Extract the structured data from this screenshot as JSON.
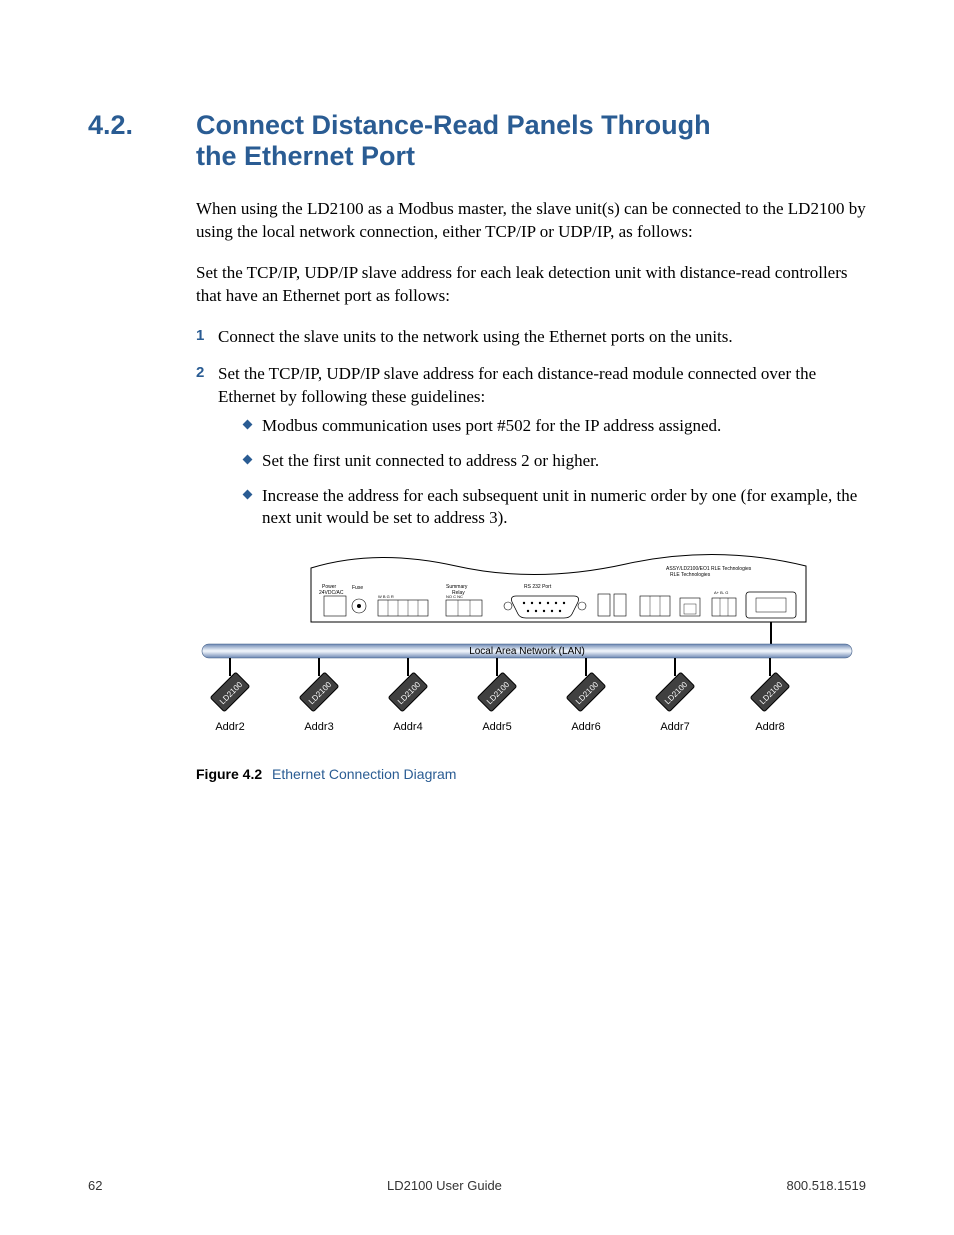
{
  "heading": {
    "number": "4.2.",
    "title": "Connect Distance-Read Panels Through the Ethernet Port"
  },
  "paragraphs": {
    "intro1": "When using the LD2100 as a Modbus master, the slave unit(s) can be connected to the LD2100 by using the local network connection, either TCP/IP or UDP/IP, as follows:",
    "intro2": "Set the TCP/IP, UDP/IP slave address for each leak detection unit with distance-read controllers that have an Ethernet port as follows:"
  },
  "steps": [
    "Connect the slave units to the network using the Ethernet ports on the units.",
    "Set the TCP/IP, UDP/IP slave address for each distance-read module connected over the Ethernet by following these guidelines:"
  ],
  "bullets": [
    "Modbus communication uses port #502 for the IP address assigned.",
    "Set the first unit connected to address 2 or higher.",
    "Increase the address for each subsequent unit in numeric order by one (for example, the next unit would be set to address 3)."
  ],
  "figure": {
    "caption_label": "Figure 4.2",
    "caption_title": "Ethernet Connection Diagram",
    "lan_label": "Local Area Network (LAN)",
    "panel_labels": {
      "power": "Power\n24VDC/AC",
      "fuse": "Fuse",
      "relay": "Summary\nRelay",
      "relay_pins": "NO  C  NC",
      "rs232": "RS 232 Port",
      "assy": "ASSY/LD2100/EO1\nRLE Technologies"
    },
    "device_label": "LD2100",
    "nodes": [
      {
        "addr": "Addr2"
      },
      {
        "addr": "Addr3"
      },
      {
        "addr": "Addr4"
      },
      {
        "addr": "Addr5"
      },
      {
        "addr": "Addr6"
      },
      {
        "addr": "Addr7"
      },
      {
        "addr": "Addr8"
      }
    ]
  },
  "footer": {
    "page": "62",
    "center": "LD2100 User Guide",
    "right": "800.518.1519"
  }
}
